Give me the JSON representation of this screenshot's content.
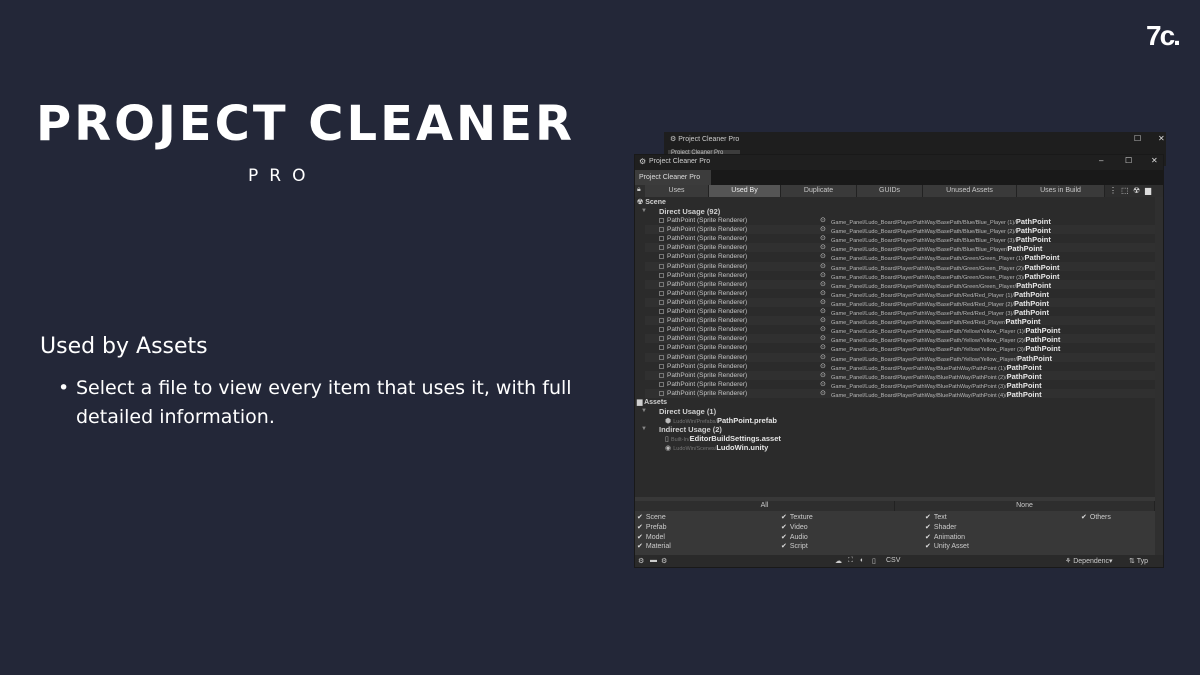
{
  "slide": {
    "logo": "7c.",
    "title": "PROJECT CLEANER",
    "subtitle": "PRO",
    "section_heading": "Used by Assets",
    "bullet": "Select a file to view every item that uses it, with full detailed information."
  },
  "window": {
    "bg_title": "Project Cleaner Pro",
    "bg_tab": "Project Cleaner Pro",
    "title": "Project Cleaner Pro",
    "tab": "Project Cleaner Pro",
    "toolbar": [
      "Uses",
      "Used By",
      "Duplicate",
      "GUIDs",
      "Unused Assets",
      "Uses in Build"
    ],
    "active_tab": "Used By",
    "scene_label": "Scene",
    "direct_usage_label": "Direct Usage (92)",
    "rows": [
      {
        "name": "PathPoint (Sprite Renderer)",
        "path": "Game_Panel/Ludo_Board/PlayerPathWay/BasePath/Blue/Blue_Player (1)/",
        "target": "PathPoint"
      },
      {
        "name": "PathPoint (Sprite Renderer)",
        "path": "Game_Panel/Ludo_Board/PlayerPathWay/BasePath/Blue/Blue_Player (2)/",
        "target": "PathPoint"
      },
      {
        "name": "PathPoint (Sprite Renderer)",
        "path": "Game_Panel/Ludo_Board/PlayerPathWay/BasePath/Blue/Blue_Player (3)/",
        "target": "PathPoint"
      },
      {
        "name": "PathPoint (Sprite Renderer)",
        "path": "Game_Panel/Ludo_Board/PlayerPathWay/BasePath/Blue/Blue_Player/",
        "target": "PathPoint"
      },
      {
        "name": "PathPoint (Sprite Renderer)",
        "path": "Game_Panel/Ludo_Board/PlayerPathWay/BasePath/Green/Green_Player (1)/",
        "target": "PathPoint"
      },
      {
        "name": "PathPoint (Sprite Renderer)",
        "path": "Game_Panel/Ludo_Board/PlayerPathWay/BasePath/Green/Green_Player (2)/",
        "target": "PathPoint"
      },
      {
        "name": "PathPoint (Sprite Renderer)",
        "path": "Game_Panel/Ludo_Board/PlayerPathWay/BasePath/Green/Green_Player (3)/",
        "target": "PathPoint"
      },
      {
        "name": "PathPoint (Sprite Renderer)",
        "path": "Game_Panel/Ludo_Board/PlayerPathWay/BasePath/Green/Green_Player/",
        "target": "PathPoint"
      },
      {
        "name": "PathPoint (Sprite Renderer)",
        "path": "Game_Panel/Ludo_Board/PlayerPathWay/BasePath/Red/Red_Player (1)/",
        "target": "PathPoint"
      },
      {
        "name": "PathPoint (Sprite Renderer)",
        "path": "Game_Panel/Ludo_Board/PlayerPathWay/BasePath/Red/Red_Player (2)/",
        "target": "PathPoint"
      },
      {
        "name": "PathPoint (Sprite Renderer)",
        "path": "Game_Panel/Ludo_Board/PlayerPathWay/BasePath/Red/Red_Player (3)/",
        "target": "PathPoint"
      },
      {
        "name": "PathPoint (Sprite Renderer)",
        "path": "Game_Panel/Ludo_Board/PlayerPathWay/BasePath/Red/Red_Player/",
        "target": "PathPoint"
      },
      {
        "name": "PathPoint (Sprite Renderer)",
        "path": "Game_Panel/Ludo_Board/PlayerPathWay/BasePath/Yellow/Yellow_Player (1)/",
        "target": "PathPoint"
      },
      {
        "name": "PathPoint (Sprite Renderer)",
        "path": "Game_Panel/Ludo_Board/PlayerPathWay/BasePath/Yellow/Yellow_Player (2)/",
        "target": "PathPoint"
      },
      {
        "name": "PathPoint (Sprite Renderer)",
        "path": "Game_Panel/Ludo_Board/PlayerPathWay/BasePath/Yellow/Yellow_Player (3)/",
        "target": "PathPoint"
      },
      {
        "name": "PathPoint (Sprite Renderer)",
        "path": "Game_Panel/Ludo_Board/PlayerPathWay/BasePath/Yellow/Yellow_Player/",
        "target": "PathPoint"
      },
      {
        "name": "PathPoint (Sprite Renderer)",
        "path": "Game_Panel/Ludo_Board/PlayerPathWay/BluePathWay/PathPoint (1)/",
        "target": "PathPoint"
      },
      {
        "name": "PathPoint (Sprite Renderer)",
        "path": "Game_Panel/Ludo_Board/PlayerPathWay/BluePathWay/PathPoint (2)/",
        "target": "PathPoint"
      },
      {
        "name": "PathPoint (Sprite Renderer)",
        "path": "Game_Panel/Ludo_Board/PlayerPathWay/BluePathWay/PathPoint (3)/",
        "target": "PathPoint"
      },
      {
        "name": "PathPoint (Sprite Renderer)",
        "path": "Game_Panel/Ludo_Board/PlayerPathWay/BluePathWay/PathPoint (4)/",
        "target": "PathPoint"
      }
    ],
    "assets_label": "Assets",
    "asset_direct_label": "Direct Usage (1)",
    "asset_direct": {
      "prefix": "LudoWin/Prefabs/",
      "name": "PathPoint.prefab"
    },
    "asset_indirect_label": "Indirect Usage (2)",
    "asset_indirect": [
      {
        "prefix": "Built-In/",
        "name": "EditorBuildSettings.asset"
      },
      {
        "prefix": "LudoWin/Scenes/",
        "name": "LudoWin.unity"
      }
    ],
    "filter_all": "All",
    "filter_none": "None",
    "filters": [
      "Scene",
      "Prefab",
      "Model",
      "Material",
      "Texture",
      "Video",
      "Audio",
      "Script",
      "Text",
      "Shader",
      "Animation",
      "Unity Asset",
      "Others"
    ],
    "footer_csv": "CSV",
    "footer_dependencies": "Dependenc▾",
    "footer_type": "Typ",
    "edge_type": "Typ"
  }
}
